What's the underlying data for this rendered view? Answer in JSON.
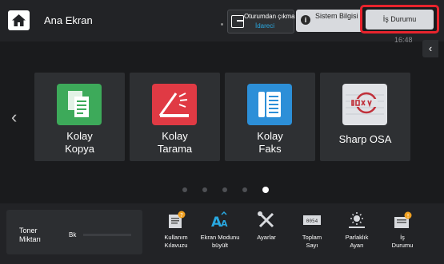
{
  "header": {
    "title": "Ana Ekran",
    "logout_label": "Oturumdan çıkma",
    "logout_user": "İdareci",
    "system_info_label": "Sistem Bilgisi",
    "job_status_label": "İş Durumu",
    "time": "16:48"
  },
  "tiles": [
    {
      "line1": "Kolay",
      "line2": "Kopya",
      "icon": "copy-icon",
      "color": "#3daa5a"
    },
    {
      "line1": "Kolay",
      "line2": "Tarama",
      "icon": "scan-icon",
      "color": "#e03a44"
    },
    {
      "line1": "Kolay",
      "line2": "Faks",
      "icon": "fax-icon",
      "color": "#2c8fd8"
    },
    {
      "line1": "Sharp OSA",
      "icon": "osa-icon",
      "color": "#e0e2e6"
    }
  ],
  "pager": {
    "count": 5,
    "active_index": 4
  },
  "toner": {
    "label_line1": "Toner",
    "label_line2": "Miktarı",
    "color_label": "Bk",
    "level": 0.0
  },
  "bottom_buttons": [
    {
      "line1": "Kullanım",
      "line2": "Kılavuzu",
      "icon": "manual-icon"
    },
    {
      "line1": "Ekran Modunu",
      "line2": "büyült",
      "icon": "font-size-icon"
    },
    {
      "line1": "Ayarlar",
      "line2": "",
      "icon": "settings-icon"
    },
    {
      "line1": "Toplam",
      "line2": "Sayı",
      "icon": "counter-icon"
    },
    {
      "line1": "Parlaklık",
      "line2": "Ayarı",
      "icon": "brightness-icon"
    },
    {
      "line1": "İş",
      "line2": "Durumu",
      "icon": "job-status-icon"
    }
  ],
  "colors": {
    "accent_blue": "#29a8e0",
    "highlight_red": "#e8242d",
    "badge_orange": "#f0a020"
  }
}
